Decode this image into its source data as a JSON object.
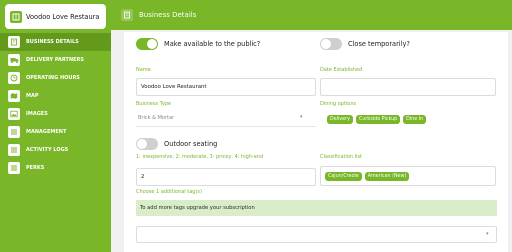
{
  "store": {
    "name": "Voodoo Love Restaura"
  },
  "sidebar": {
    "items": [
      {
        "label": "BUSINESS DETAILS",
        "icon": "building-icon",
        "active": true
      },
      {
        "label": "DELIVERY PARTNERS",
        "icon": "delivery-truck-icon",
        "active": false
      },
      {
        "label": "OPERATING HOURS",
        "icon": "clock-icon",
        "active": false
      },
      {
        "label": "MAP",
        "icon": "map-icon",
        "active": false
      },
      {
        "label": "IMAGES",
        "icon": "image-icon",
        "active": false
      },
      {
        "label": "MANAGEMENT",
        "icon": "list-icon",
        "active": false
      },
      {
        "label": "ACTIVITY LOGS",
        "icon": "list-icon",
        "active": false
      },
      {
        "label": "PERKS",
        "icon": "list-icon",
        "active": false
      }
    ]
  },
  "header": {
    "title": "Business Details"
  },
  "form": {
    "public_toggle": {
      "label": "Make available to the public?",
      "on": true
    },
    "close_toggle": {
      "label": "Close temporarily?",
      "on": false
    },
    "name": {
      "label": "Name",
      "value": "Voodoo Love Restaurant"
    },
    "date_established": {
      "label": "Date Established",
      "value": ""
    },
    "business_type": {
      "label": "Business Type",
      "value": "Brick & Mortar"
    },
    "dining_options": {
      "label": "Dining options",
      "chips": [
        "Delivery",
        "Curbside Pickup",
        "Dine In"
      ]
    },
    "outdoor_toggle": {
      "label": "Outdoor seating",
      "on": false
    },
    "price": {
      "label": "1: inexpensive, 2: moderate, 3: pricey, 4: high-end",
      "value": "2"
    },
    "classification": {
      "label": "Classification list",
      "chips": [
        "Cajun/Creole",
        "American (New)"
      ]
    },
    "tags": {
      "label": "Choose 1 additional tag(s)",
      "message": "To add more tags upgrade your subscription"
    }
  },
  "colors": {
    "accent": "#79b628",
    "accent_dark": "#649a1c",
    "chip_bg": "#79b628",
    "upgrade_bg": "#d9edc8"
  }
}
